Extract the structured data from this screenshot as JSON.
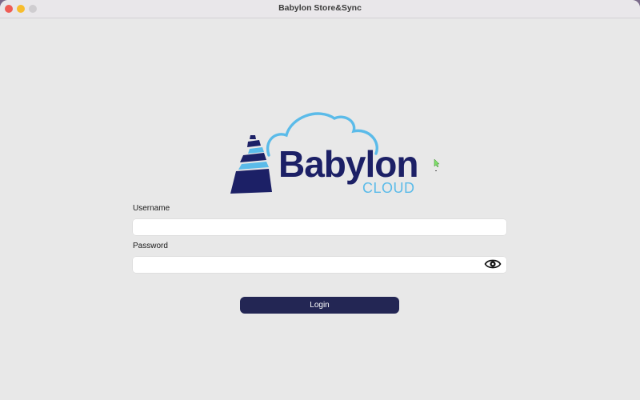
{
  "window": {
    "title": "Babylon Store&Sync"
  },
  "logo": {
    "name": "Babylon",
    "subtitle": "CLOUD",
    "colors": {
      "navy": "#1c2066",
      "sky": "#5bbbe9"
    }
  },
  "form": {
    "username": {
      "label": "Username",
      "value": "",
      "placeholder": ""
    },
    "password": {
      "label": "Password",
      "value": "",
      "placeholder": "",
      "reveal_icon": "eye-icon"
    },
    "submit_label": "Login"
  },
  "colors": {
    "window_bg": "#e8e8e8",
    "button_bg": "#232654",
    "button_text": "#ffffff"
  }
}
